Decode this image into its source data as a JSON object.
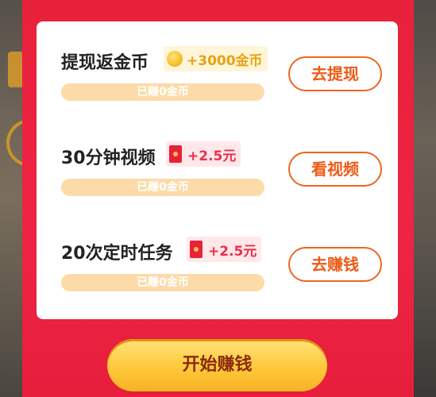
{
  "tasks": [
    {
      "title": "提现返金币",
      "reward_type": "coin",
      "reward": "+3000金币",
      "progress": "已赚0金币",
      "action": "去提现"
    },
    {
      "title": "30分钟视频",
      "reward_type": "cash",
      "reward": "+2.5元",
      "progress": "已赚0金币",
      "action": "看视频"
    },
    {
      "title": "20次定时任务",
      "reward_type": "cash",
      "reward": "+2.5元",
      "progress": "已赚0金币",
      "action": "去赚钱"
    }
  ],
  "start_button": "开始赚钱",
  "colors": {
    "panel_red": "#e8213a",
    "action_orange": "#f0651f",
    "coin_gold": "#e6a313",
    "progress_bg": "#fcdba8",
    "start_yellow": "#ffc93a"
  }
}
